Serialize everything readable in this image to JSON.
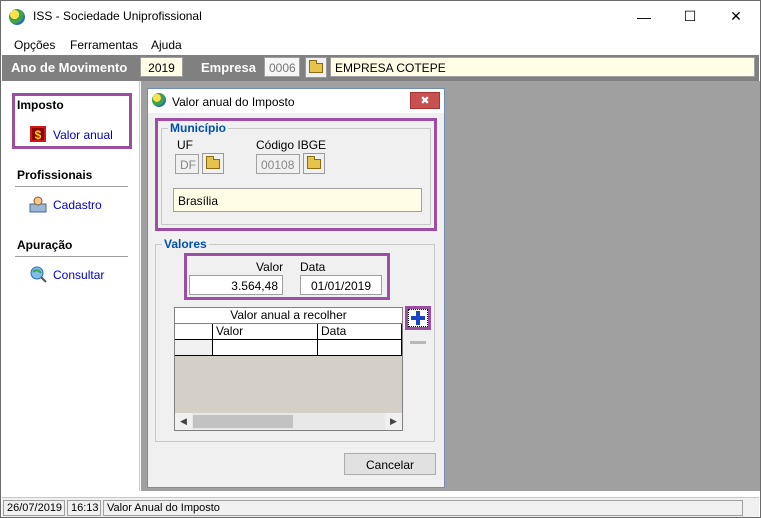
{
  "window": {
    "title": "ISS - Sociedade Uniprofissional"
  },
  "menu": {
    "items": [
      "Opções",
      "Ferramentas",
      "Ajuda"
    ]
  },
  "topbar": {
    "ano_label": "Ano de Movimento",
    "ano_value": "2019",
    "empresa_label": "Empresa",
    "empresa_code": "0006",
    "empresa_name": "EMPRESA COTEPE"
  },
  "sidebar": {
    "sections": [
      {
        "title": "Imposto",
        "link": "Valor anual"
      },
      {
        "title": "Profissionais",
        "link": "Cadastro"
      },
      {
        "title": "Apuração",
        "link": "Consultar"
      }
    ]
  },
  "dialog": {
    "title": "Valor anual do Imposto",
    "municipio": {
      "group_title": "Município",
      "uf_label": "UF",
      "uf_value": "DF",
      "ibge_label": "Código IBGE",
      "ibge_value": "00108",
      "cidade": "Brasília"
    },
    "valores": {
      "group_title": "Valores",
      "valor_label": "Valor",
      "valor_value": "3.564,48",
      "data_label": "Data",
      "data_value": "01/01/2019",
      "grid_title": "Valor anual a recolher",
      "grid_columns": [
        "Valor",
        "Data"
      ]
    },
    "cancel_label": "Cancelar"
  },
  "status": {
    "date": "26/07/2019",
    "time": "16:13",
    "message": "Valor Anual do Imposto"
  }
}
